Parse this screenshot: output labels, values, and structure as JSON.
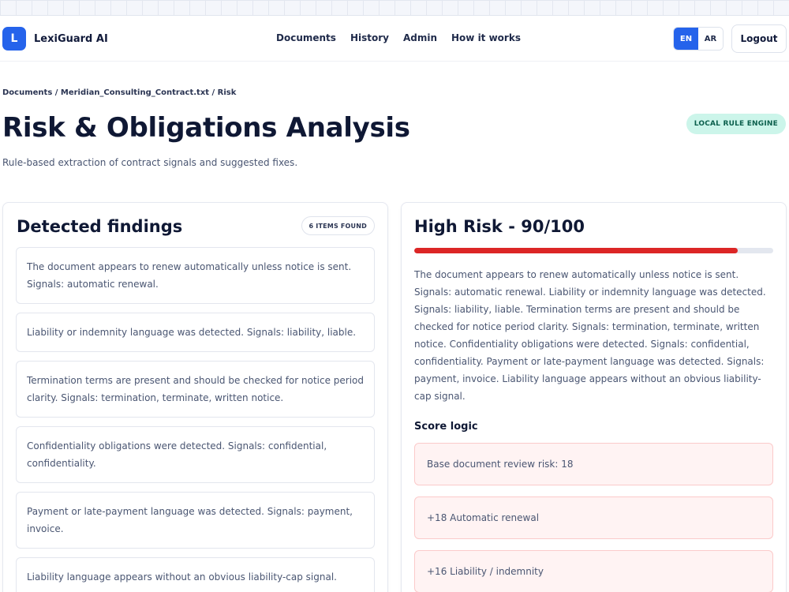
{
  "app": {
    "logo_letter": "L",
    "name": "LexiGuard AI"
  },
  "nav": {
    "links": [
      "Documents",
      "History",
      "Admin",
      "How it works"
    ]
  },
  "language": {
    "options": [
      "EN",
      "AR"
    ],
    "selected": "EN"
  },
  "header": {
    "logout_label": "Logout"
  },
  "breadcrumb": "Documents / Meridian_Consulting_Contract.txt / Risk",
  "page": {
    "title": "Risk & Obligations Analysis",
    "subtitle": "Rule-based extraction of contract signals and suggested fixes.",
    "engine_badge": "LOCAL RULE ENGINE"
  },
  "findings": {
    "title": "Detected findings",
    "count_badge": "6 ITEMS FOUND",
    "items": [
      "The document appears to renew automatically unless notice is sent. Signals: automatic renewal.",
      "Liability or indemnity language was detected. Signals: liability, liable.",
      "Termination terms are present and should be checked for notice period clarity. Signals: termination, terminate, written notice.",
      "Confidentiality obligations were detected. Signals: confidential, confidentiality.",
      "Payment or late-payment language was detected. Signals: payment, invoice.",
      "Liability language appears without an obvious liability-cap signal."
    ]
  },
  "risk": {
    "title": "High Risk - 90/100",
    "level": "High Risk",
    "score": 90,
    "max_score": 100,
    "bar_color": "#dc2626",
    "summary": "The document appears to renew automatically unless notice is sent. Signals: automatic renewal. Liability or indemnity language was detected. Signals: liability, liable. Termination terms are present and should be checked for notice period clarity. Signals: termination, terminate, written notice. Confidentiality obligations were detected. Signals: confidential, confidentiality. Payment or late-payment language was detected. Signals: payment, invoice. Liability language appears without an obvious liability-cap signal.",
    "score_logic_title": "Score logic",
    "score_logic": [
      "Base document review risk: 18",
      "+18 Automatic renewal",
      "+16 Liability / indemnity"
    ]
  },
  "colors": {
    "accent": "#2563eb",
    "risk_high": "#dc2626",
    "engine_badge_bg": "#ccf5ea",
    "score_item_bg": "#fff3f3"
  }
}
